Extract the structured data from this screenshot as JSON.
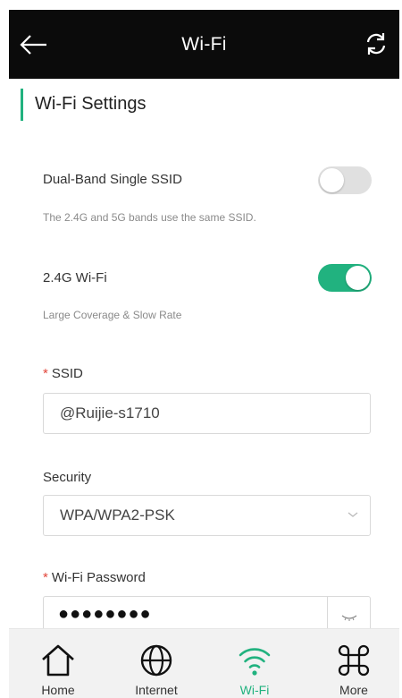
{
  "header": {
    "title": "Wi-Fi"
  },
  "section": {
    "title": "Wi-Fi Settings"
  },
  "dual_band": {
    "label": "Dual-Band Single SSID",
    "description": "The 2.4G and 5G bands use the same SSID.",
    "enabled": false
  },
  "wifi24": {
    "label": "2.4G Wi-Fi",
    "description": "Large Coverage & Slow Rate",
    "enabled": true
  },
  "ssid": {
    "required_mark": "*",
    "label": "SSID",
    "value": "@Ruijie-s1710"
  },
  "security": {
    "label": "Security",
    "value": "WPA/WPA2-PSK"
  },
  "password": {
    "required_mark": "*",
    "label": "Wi-Fi Password",
    "masked_value": "●●●●●●●●"
  },
  "nav": {
    "home": "Home",
    "internet": "Internet",
    "wifi": "Wi-Fi",
    "more": "More"
  },
  "colors": {
    "accent": "#21b27f",
    "header_bg": "#0b0b0b",
    "required": "#e2463b"
  }
}
